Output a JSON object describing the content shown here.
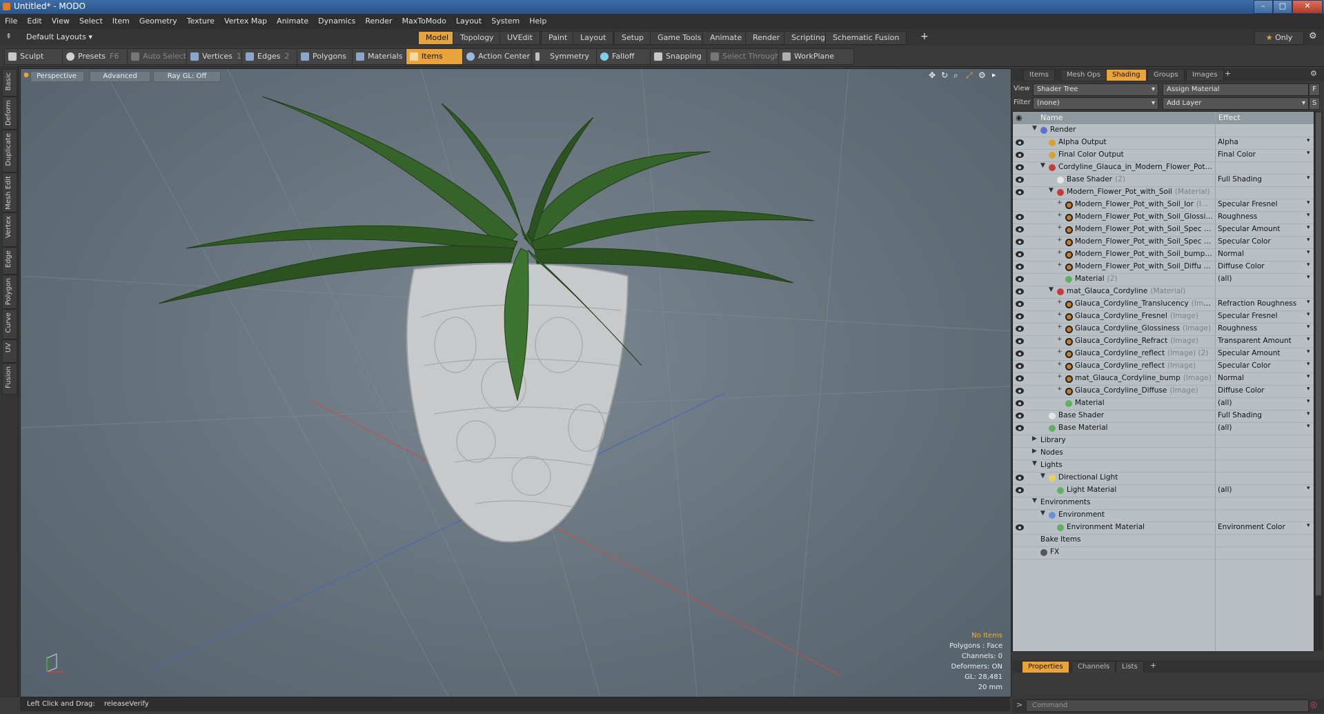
{
  "window": {
    "title": "Untitled* - MODO",
    "minimize": "–",
    "maximize": "□",
    "close": "✕"
  },
  "menu": [
    "File",
    "Edit",
    "View",
    "Select",
    "Item",
    "Geometry",
    "Texture",
    "Vertex Map",
    "Animate",
    "Dynamics",
    "Render",
    "MaxToModo",
    "Layout",
    "System",
    "Help"
  ],
  "layoutbar": {
    "layout_select": "Default Layouts",
    "tabs": [
      "Model",
      "Topology",
      "UVEdit",
      "Paint",
      "Layout",
      "Setup",
      "Game Tools",
      "Animate",
      "Render",
      "Scripting",
      "Schematic Fusion"
    ],
    "active_tab": "Model",
    "add": "+",
    "only": "Only"
  },
  "toolbar": {
    "sculpt": "Sculpt",
    "presets": "Presets",
    "presets_key": "F6",
    "auto_select": "Auto Select",
    "vertices": "Vertices",
    "vertices_key": "1",
    "edges": "Edges",
    "edges_key": "2",
    "polygons": "Polygons",
    "materials": "Materials",
    "items": "Items",
    "action_center": "Action Center",
    "symmetry": "Symmetry",
    "falloff": "Falloff",
    "snapping": "Snapping",
    "select_through": "Select Through",
    "workplane": "WorkPlane"
  },
  "left_tabs": [
    "Basic",
    "Deform",
    "Duplicate",
    "Mesh Edit",
    "Vertex",
    "Edge",
    "Polygon",
    "Curve",
    "UV",
    "Fusion"
  ],
  "viewport": {
    "view_mode": "Perspective",
    "advanced": "Advanced",
    "raygl": "Ray GL: Off",
    "info": {
      "items": "No Items",
      "polygons": "Polygons : Face",
      "channels": "Channels: 0",
      "deformers": "Deformers: ON",
      "gl": "GL: 28,481",
      "scale": "20 mm"
    }
  },
  "status": {
    "hint": "Left Click and Drag:",
    "action": "releaseVerify"
  },
  "right_panel": {
    "tabs": [
      "Items",
      "Mesh Ops",
      "Shading",
      "Groups",
      "Images"
    ],
    "active_tab": "Shading",
    "add": "+",
    "view_label": "View",
    "view_value": "Shader Tree",
    "assign_material": "Assign Material",
    "assign_key": "F",
    "filter_label": "Filter",
    "filter_value": "(none)",
    "add_layer": "Add Layer",
    "add_layer_key": "S",
    "col_name": "Name",
    "col_effect": "Effect",
    "rows": [
      {
        "depth": 0,
        "exp": "▼",
        "name": "Render",
        "sub": "",
        "effect": "",
        "eye": false,
        "icon": "render",
        "dd": false
      },
      {
        "depth": 1,
        "exp": "",
        "name": "Alpha Output",
        "sub": "",
        "effect": "Alpha",
        "eye": true,
        "icon": "output",
        "dd": true
      },
      {
        "depth": 1,
        "exp": "",
        "name": "Final Color Output",
        "sub": "",
        "effect": "Final Color",
        "eye": true,
        "icon": "output",
        "dd": true
      },
      {
        "depth": 1,
        "exp": "▼",
        "name": "Cordyline_Glauca_in_Modern_Flower_Pot…",
        "sub": "",
        "effect": "",
        "eye": true,
        "icon": "group",
        "dd": false
      },
      {
        "depth": 2,
        "exp": "",
        "name": "Base Shader",
        "sub": "(2)",
        "effect": "Full Shading",
        "eye": true,
        "icon": "shader",
        "dd": true
      },
      {
        "depth": 2,
        "exp": "▼",
        "name": "Modern_Flower_Pot_with_Soil",
        "sub": "(Material)",
        "effect": "",
        "eye": true,
        "icon": "group",
        "dd": false
      },
      {
        "depth": 3,
        "exp": "+",
        "name": "Modern_Flower_Pot_with_Soil_Ior",
        "sub": "(I…",
        "effect": "Specular Fresnel",
        "eye": false,
        "icon": "image",
        "dd": true
      },
      {
        "depth": 3,
        "exp": "+",
        "name": "Modern_Flower_Pot_with_Soil_Glossi…",
        "sub": "",
        "effect": "Roughness",
        "eye": true,
        "icon": "image",
        "dd": true
      },
      {
        "depth": 3,
        "exp": "+",
        "name": "Modern_Flower_Pot_with_Soil_Spec …",
        "sub": "",
        "effect": "Specular Amount",
        "eye": true,
        "icon": "image",
        "dd": true
      },
      {
        "depth": 3,
        "exp": "+",
        "name": "Modern_Flower_Pot_with_Soil_Spec …",
        "sub": "",
        "effect": "Specular Color",
        "eye": true,
        "icon": "image",
        "dd": true
      },
      {
        "depth": 3,
        "exp": "+",
        "name": "Modern_Flower_Pot_with_Soil_bump…",
        "sub": "",
        "effect": "Normal",
        "eye": true,
        "icon": "image",
        "dd": true
      },
      {
        "depth": 3,
        "exp": "+",
        "name": "Modern_Flower_Pot_with_Soil_Diffu …",
        "sub": "",
        "effect": "Diffuse Color",
        "eye": true,
        "icon": "image",
        "dd": true
      },
      {
        "depth": 3,
        "exp": "",
        "name": "Material",
        "sub": "(2)",
        "effect": "(all)",
        "eye": true,
        "icon": "material",
        "dd": true
      },
      {
        "depth": 2,
        "exp": "▼",
        "name": "mat_Glauca_Cordyline",
        "sub": "(Material)",
        "effect": "",
        "eye": true,
        "icon": "group",
        "dd": false
      },
      {
        "depth": 3,
        "exp": "+",
        "name": "Glauca_Cordyline_Translucency",
        "sub": "(Ima…",
        "effect": "Refraction Roughness",
        "eye": true,
        "icon": "image",
        "dd": true
      },
      {
        "depth": 3,
        "exp": "+",
        "name": "Glauca_Cordyline_Fresnel",
        "sub": "(Image)",
        "effect": "Specular Fresnel",
        "eye": true,
        "icon": "image",
        "dd": true
      },
      {
        "depth": 3,
        "exp": "+",
        "name": "Glauca_Cordyline_Glossiness",
        "sub": "(Image)",
        "effect": "Roughness",
        "eye": true,
        "icon": "image",
        "dd": true
      },
      {
        "depth": 3,
        "exp": "+",
        "name": "Glauca_Cordyline_Refract",
        "sub": "(Image)",
        "effect": "Transparent Amount",
        "eye": true,
        "icon": "image",
        "dd": true
      },
      {
        "depth": 3,
        "exp": "+",
        "name": "Glauca_Cordyline_reflect",
        "sub": "(Image) (2)",
        "effect": "Specular Amount",
        "eye": true,
        "icon": "image",
        "dd": true
      },
      {
        "depth": 3,
        "exp": "+",
        "name": "Glauca_Cordyline_reflect",
        "sub": "(Image)",
        "effect": "Specular Color",
        "eye": true,
        "icon": "image",
        "dd": true
      },
      {
        "depth": 3,
        "exp": "+",
        "name": "mat_Glauca_Cordyline_bump",
        "sub": "(Image)",
        "effect": "Normal",
        "eye": true,
        "icon": "image",
        "dd": true
      },
      {
        "depth": 3,
        "exp": "+",
        "name": "Glauca_Cordyline_Diffuse",
        "sub": "(Image)",
        "effect": "Diffuse Color",
        "eye": true,
        "icon": "image",
        "dd": true
      },
      {
        "depth": 3,
        "exp": "",
        "name": "Material",
        "sub": "",
        "effect": "(all)",
        "eye": true,
        "icon": "material",
        "dd": true
      },
      {
        "depth": 1,
        "exp": "",
        "name": "Base Shader",
        "sub": "",
        "effect": "Full Shading",
        "eye": true,
        "icon": "shader",
        "dd": true
      },
      {
        "depth": 1,
        "exp": "",
        "name": "Base Material",
        "sub": "",
        "effect": "(all)",
        "eye": true,
        "icon": "material",
        "dd": true
      },
      {
        "depth": 0,
        "exp": "▶",
        "name": "Library",
        "sub": "",
        "effect": "",
        "eye": false,
        "icon": "none",
        "dd": false
      },
      {
        "depth": 0,
        "exp": "▶",
        "name": "Nodes",
        "sub": "",
        "effect": "",
        "eye": false,
        "icon": "none",
        "dd": false
      },
      {
        "depth": 0,
        "exp": "▼",
        "name": "Lights",
        "sub": "",
        "effect": "",
        "eye": false,
        "icon": "none",
        "dd": false
      },
      {
        "depth": 1,
        "exp": "▼",
        "name": "Directional Light",
        "sub": "",
        "effect": "",
        "eye": true,
        "icon": "light",
        "dd": false
      },
      {
        "depth": 2,
        "exp": "",
        "name": "Light Material",
        "sub": "",
        "effect": "(all)",
        "eye": true,
        "icon": "material",
        "dd": true
      },
      {
        "depth": 0,
        "exp": "▼",
        "name": "Environments",
        "sub": "",
        "effect": "",
        "eye": false,
        "icon": "none",
        "dd": false
      },
      {
        "depth": 1,
        "exp": "▼",
        "name": "Environment",
        "sub": "",
        "effect": "",
        "eye": false,
        "icon": "env",
        "dd": false
      },
      {
        "depth": 2,
        "exp": "",
        "name": "Environment Material",
        "sub": "",
        "effect": "Environment Color",
        "eye": true,
        "icon": "material",
        "dd": true
      },
      {
        "depth": 0,
        "exp": "",
        "name": "Bake Items",
        "sub": "",
        "effect": "",
        "eye": false,
        "icon": "none",
        "dd": false
      },
      {
        "depth": 0,
        "exp": "",
        "name": "FX",
        "sub": "",
        "effect": "",
        "eye": false,
        "icon": "fx",
        "dd": false
      }
    ],
    "bottom_tabs": [
      "Properties",
      "Channels",
      "Lists"
    ],
    "bottom_active": "Properties",
    "command_placeholder": "Command"
  },
  "colors": {
    "accent": "#e8a33a",
    "panel": "#3a3a3a",
    "tree_bg": "#b9c0c5"
  }
}
